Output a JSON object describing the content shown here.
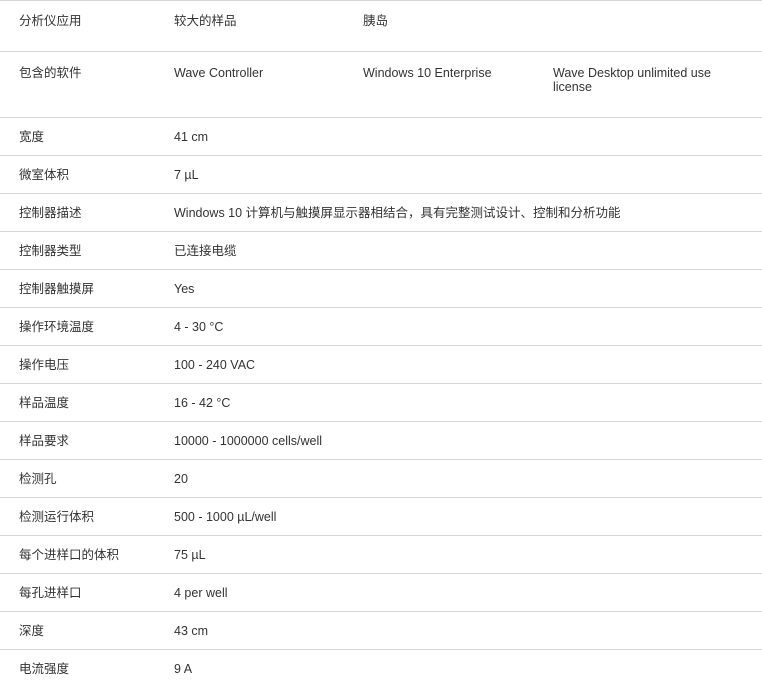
{
  "rows": [
    {
      "label": "分析仪应用",
      "values": [
        "较大的样品",
        "胰岛"
      ]
    },
    {
      "label": "包含的软件",
      "values": [
        "Wave Controller",
        "Windows 10 Enterprise",
        "Wave Desktop unlimited use license"
      ]
    },
    {
      "label": "宽度",
      "values": [
        "41 cm"
      ]
    },
    {
      "label": "微室体积",
      "values": [
        "7 µL"
      ]
    },
    {
      "label": "控制器描述",
      "values": [
        "Windows 10 计算机与触摸屏显示器相结合，具有完整测试设计、控制和分析功能"
      ]
    },
    {
      "label": "控制器类型",
      "values": [
        "已连接电缆"
      ]
    },
    {
      "label": "控制器触摸屏",
      "values": [
        "Yes"
      ]
    },
    {
      "label": "操作环境温度",
      "values": [
        "4 - 30 °C"
      ]
    },
    {
      "label": "操作电压",
      "values": [
        "100 - 240 VAC"
      ]
    },
    {
      "label": "样品温度",
      "values": [
        "16 - 42 °C"
      ]
    },
    {
      "label": "样品要求",
      "values": [
        "10000 - 1000000 cells/well"
      ]
    },
    {
      "label": "检测孔",
      "values": [
        "20"
      ]
    },
    {
      "label": "检测运行体积",
      "values": [
        "500 - 1000 µL/well"
      ]
    },
    {
      "label": "每个进样口的体积",
      "values": [
        "75 µL"
      ]
    },
    {
      "label": "每孔进样口",
      "values": [
        "4 per well"
      ]
    },
    {
      "label": "深度",
      "values": [
        "43 cm"
      ]
    },
    {
      "label": "电流强度",
      "values": [
        "9 A"
      ]
    }
  ]
}
